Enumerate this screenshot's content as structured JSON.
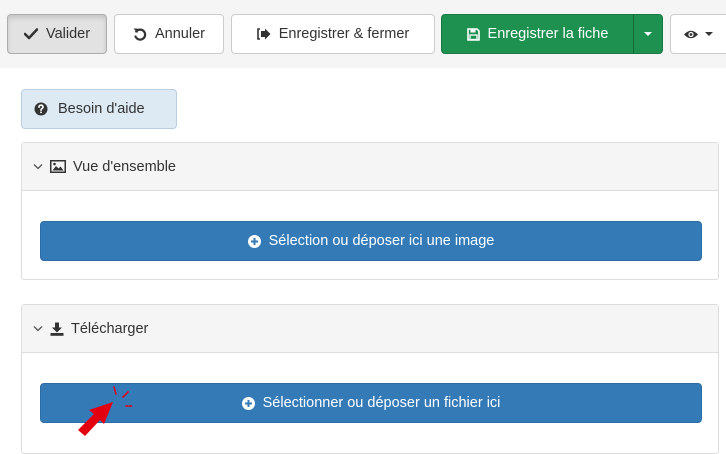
{
  "toolbar": {
    "valider_label": "Valider",
    "annuler_label": "Annuler",
    "enregistrer_fermer_label": "Enregistrer & fermer",
    "enregistrer_fiche_label": "Enregistrer la fiche"
  },
  "help": {
    "label": "Besoin d'aide"
  },
  "panels": [
    {
      "title": "Vue d'ensemble",
      "button_label": "Sélection ou déposer ici une image"
    },
    {
      "title": "Télécharger",
      "button_label": "Sélectionner ou déposer un fichier ici"
    }
  ],
  "colors": {
    "primary": "#337ab7",
    "success": "#1e9150",
    "help_bg": "#dde9f3",
    "cursor": "#e3000f"
  },
  "icons": {
    "valider": "check-icon",
    "annuler": "undo-icon",
    "enregistrer_fermer": "sign-out-icon",
    "enregistrer_fiche": "floppy-disk-icon",
    "preview": "eye-icon",
    "help": "question-circle-icon",
    "panel1": "image-icon",
    "panel2": "download-icon",
    "upload": "plus-circle-icon"
  }
}
